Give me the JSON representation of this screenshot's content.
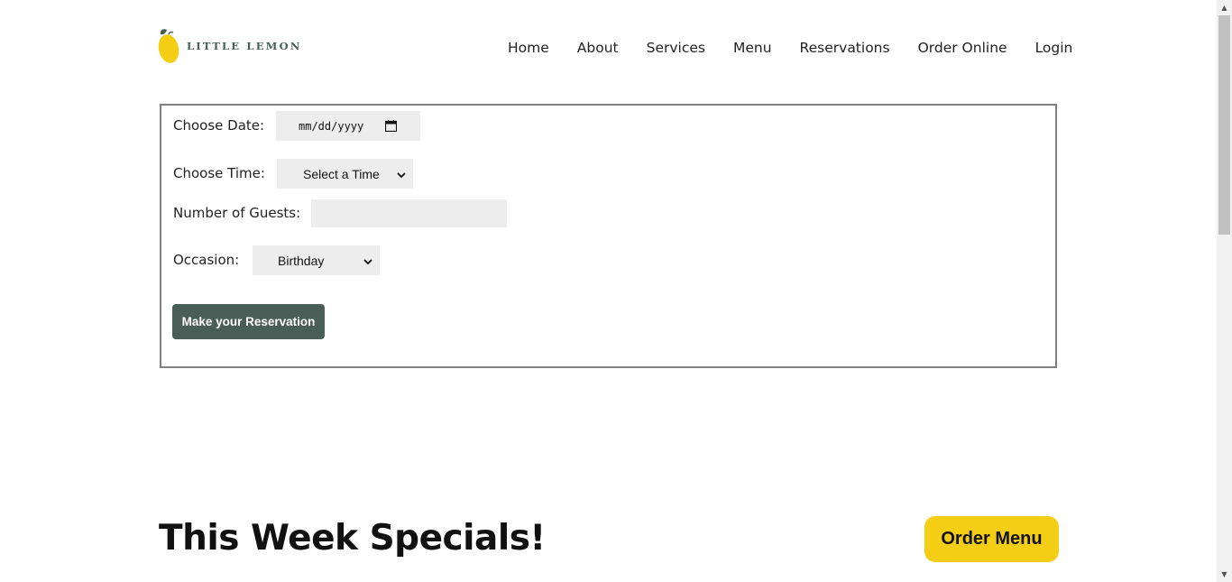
{
  "brand": {
    "name": "LITTLE LEMON",
    "logo_icon": "lemon-icon"
  },
  "nav": {
    "items": [
      "Home",
      "About",
      "Services",
      "Menu",
      "Reservations",
      "Order Online",
      "Login"
    ]
  },
  "form": {
    "date": {
      "label": "Choose Date:",
      "placeholder": "mm/dd/yyyy",
      "icon": "calendar-icon"
    },
    "time": {
      "label": "Choose Time:",
      "selected": "Select a Time"
    },
    "guests": {
      "label": "Number of Guests:",
      "value": ""
    },
    "occasion": {
      "label": "Occasion:",
      "selected": "Birthday"
    },
    "submit_label": "Make your Reservation"
  },
  "specials": {
    "title": "This Week Specials!",
    "order_button": "Order Menu"
  },
  "colors": {
    "primary_green": "#495e57",
    "accent_yellow": "#f4ce14",
    "field_bg": "#ededed"
  }
}
